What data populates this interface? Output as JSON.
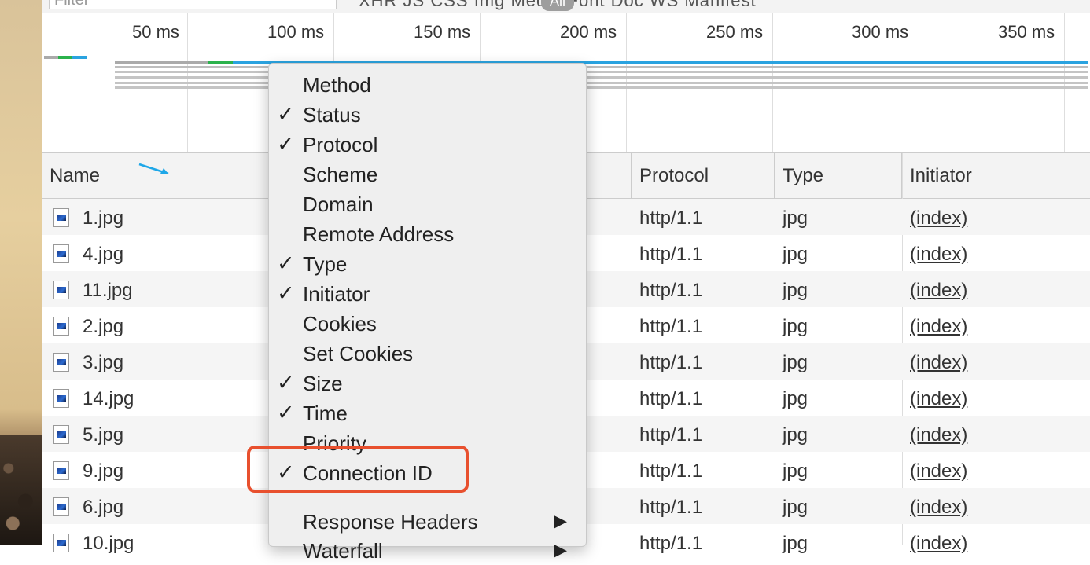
{
  "filter": {
    "placeholder": "Filter",
    "types_label": "XHR JS CSS Img Media Font Doc WS Manifest",
    "all_label": "All"
  },
  "timeline": {
    "ticks": [
      "50 ms",
      "100 ms",
      "150 ms",
      "200 ms",
      "250 ms",
      "300 ms",
      "350 ms"
    ]
  },
  "table": {
    "headers": {
      "name": "Name",
      "protocol": "Protocol",
      "type": "Type",
      "initiator": "Initiator"
    },
    "rows": [
      {
        "name": "1.jpg",
        "protocol": "http/1.1",
        "type": "jpg",
        "initiator": "(index)"
      },
      {
        "name": "4.jpg",
        "protocol": "http/1.1",
        "type": "jpg",
        "initiator": "(index)"
      },
      {
        "name": "11.jpg",
        "protocol": "http/1.1",
        "type": "jpg",
        "initiator": "(index)"
      },
      {
        "name": "2.jpg",
        "protocol": "http/1.1",
        "type": "jpg",
        "initiator": "(index)"
      },
      {
        "name": "3.jpg",
        "protocol": "http/1.1",
        "type": "jpg",
        "initiator": "(index)"
      },
      {
        "name": "14.jpg",
        "protocol": "http/1.1",
        "type": "jpg",
        "initiator": "(index)"
      },
      {
        "name": "5.jpg",
        "protocol": "http/1.1",
        "type": "jpg",
        "initiator": "(index)"
      },
      {
        "name": "9.jpg",
        "protocol": "http/1.1",
        "type": "jpg",
        "initiator": "(index)"
      },
      {
        "name": "6.jpg",
        "protocol": "http/1.1",
        "type": "jpg",
        "initiator": "(index)"
      },
      {
        "name": "10.jpg",
        "protocol": "http/1.1",
        "type": "jpg",
        "initiator": "(index)"
      }
    ]
  },
  "context_menu": {
    "items": [
      {
        "label": "Method",
        "checked": false
      },
      {
        "label": "Status",
        "checked": true
      },
      {
        "label": "Protocol",
        "checked": true
      },
      {
        "label": "Scheme",
        "checked": false
      },
      {
        "label": "Domain",
        "checked": false
      },
      {
        "label": "Remote Address",
        "checked": false
      },
      {
        "label": "Type",
        "checked": true
      },
      {
        "label": "Initiator",
        "checked": true
      },
      {
        "label": "Cookies",
        "checked": false
      },
      {
        "label": "Set Cookies",
        "checked": false
      },
      {
        "label": "Size",
        "checked": true
      },
      {
        "label": "Time",
        "checked": true
      },
      {
        "label": "Priority",
        "checked": false
      },
      {
        "label": "Connection ID",
        "checked": true
      }
    ],
    "submenus": [
      {
        "label": "Response Headers"
      },
      {
        "label": "Waterfall"
      }
    ],
    "check_glyph": "✓",
    "submenu_glyph": "▶"
  },
  "colors": {
    "highlight": "#e8502e",
    "waterfall_blue": "#2aa3e0",
    "waterfall_green": "#2bb24c",
    "arrow": "#1ea7e8"
  }
}
